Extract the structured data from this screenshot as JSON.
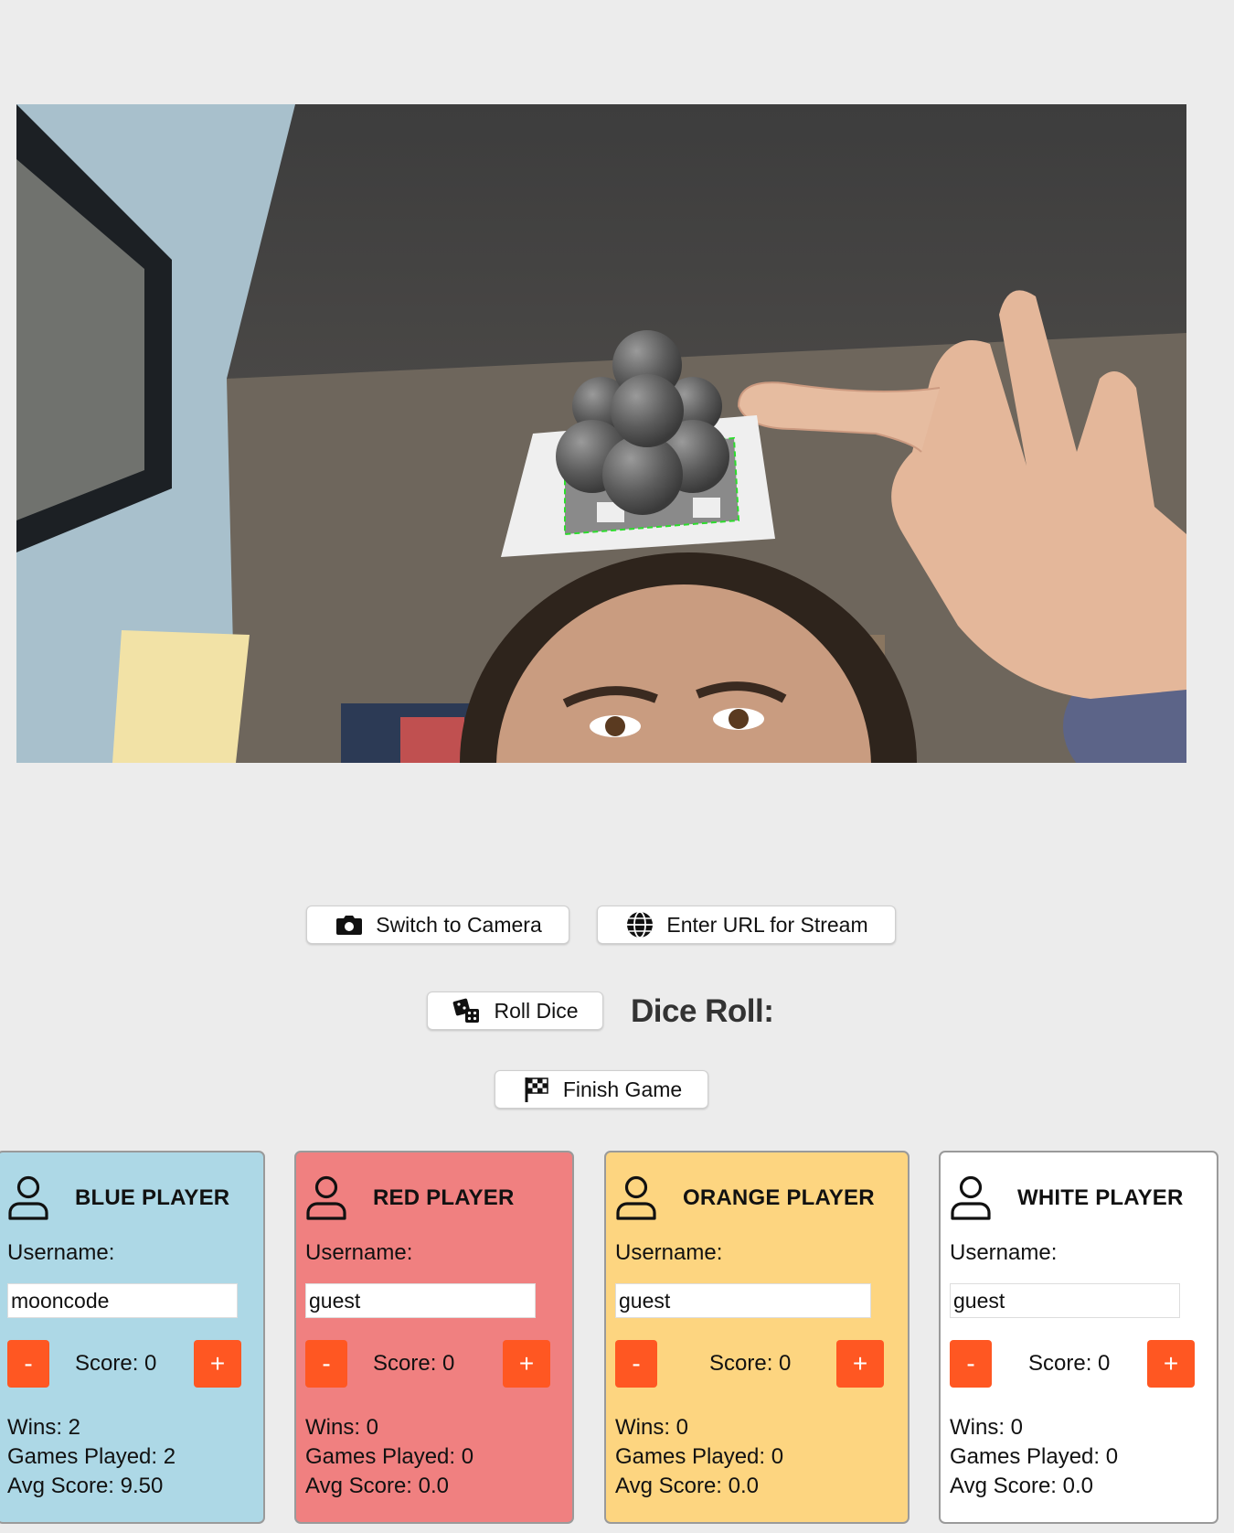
{
  "controls": {
    "switch_camera": "Switch to Camera",
    "enter_url": "Enter URL for Stream",
    "roll_dice": "Roll Dice",
    "dice_roll_label": "Dice Roll:",
    "finish_game": "Finish Game"
  },
  "players": [
    {
      "title": "BLUE PLAYER",
      "username_label": "Username:",
      "username": "mooncode",
      "minus": "-",
      "plus": "+",
      "score": "Score: 0",
      "wins": "Wins: 2",
      "games_played": "Games Played: 2",
      "avg_score": "Avg Score: 9.50",
      "color": "#add8e6"
    },
    {
      "title": "RED PLAYER",
      "username_label": "Username:",
      "username": "guest",
      "minus": "-",
      "plus": "+",
      "score": "Score: 0",
      "wins": "Wins: 0",
      "games_played": "Games Played: 0",
      "avg_score": "Avg Score: 0.0",
      "color": "#f08080"
    },
    {
      "title": "ORANGE PLAYER",
      "username_label": "Username:",
      "username": "guest",
      "minus": "-",
      "plus": "+",
      "score": "Score: 0",
      "wins": "Wins: 0",
      "games_played": "Games Played: 0",
      "avg_score": "Avg Score: 0.0",
      "color": "#fdd580"
    },
    {
      "title": "WHITE PLAYER",
      "username_label": "Username:",
      "username": "guest",
      "minus": "-",
      "plus": "+",
      "score": "Score: 0",
      "wins": "Wins: 0",
      "games_played": "Games Played: 0",
      "avg_score": "Avg Score: 0.0",
      "color": "#ffffff"
    }
  ],
  "icons": {
    "camera": "camera-icon",
    "globe": "globe-icon",
    "dice": "dice-icon",
    "finish": "checkered-flag-icon",
    "user": "user-icon"
  },
  "accent": "#ff5722"
}
